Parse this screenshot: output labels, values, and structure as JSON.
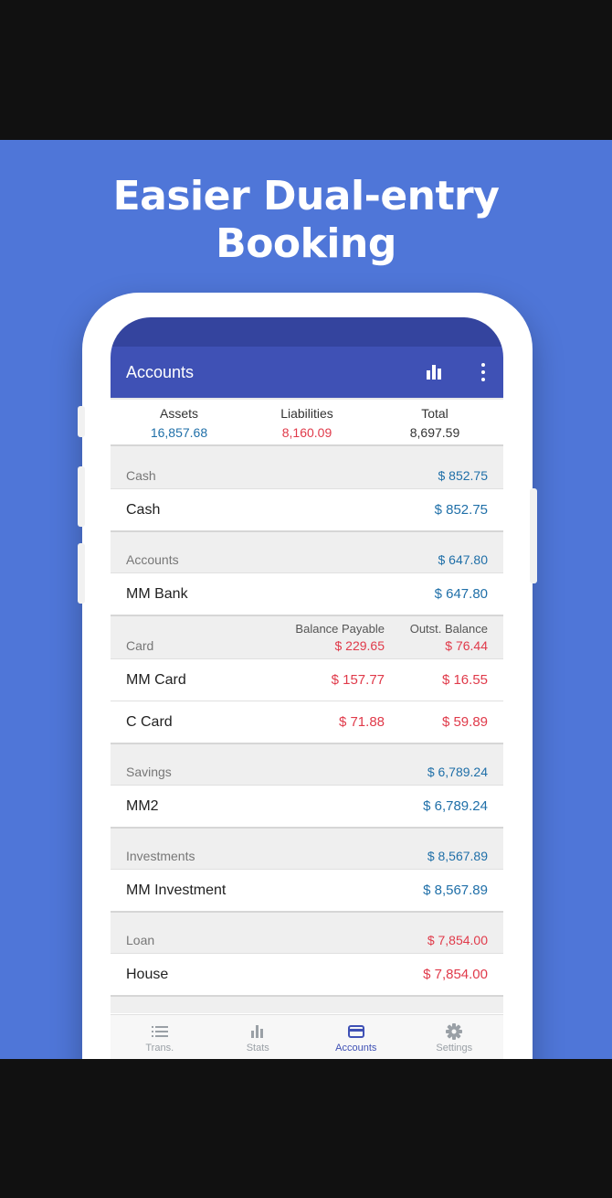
{
  "headline": {
    "line1": "Easier Dual-entry",
    "line2": "Booking"
  },
  "app": {
    "title": "Accounts",
    "icons": {
      "stats": "bar-chart-icon",
      "more": "more-vert-icon"
    }
  },
  "summary": {
    "assets_label": "Assets",
    "assets_value": "16,857.68",
    "liabilities_label": "Liabilities",
    "liabilities_value": "8,160.09",
    "total_label": "Total",
    "total_value": "8,697.59"
  },
  "groups": {
    "cash": {
      "name": "Cash",
      "amount": "$ 852.75",
      "rows": [
        {
          "name": "Cash",
          "amount": "$ 852.75"
        }
      ]
    },
    "accounts": {
      "name": "Accounts",
      "amount": "$ 647.80",
      "rows": [
        {
          "name": "MM Bank",
          "amount": "$ 647.80"
        }
      ]
    },
    "card": {
      "name": "Card",
      "balance_payable_label": "Balance Payable",
      "balance_payable": "$ 229.65",
      "outst_balance_label": "Outst. Balance",
      "outst_balance": "$ 76.44",
      "rows": [
        {
          "name": "MM Card",
          "payable": "$ 157.77",
          "outst": "$ 16.55"
        },
        {
          "name": "C Card",
          "payable": "$ 71.88",
          "outst": "$ 59.89"
        }
      ]
    },
    "savings": {
      "name": "Savings",
      "amount": "$ 6,789.24",
      "rows": [
        {
          "name": "MM2",
          "amount": "$ 6,789.24"
        }
      ]
    },
    "investments": {
      "name": "Investments",
      "amount": "$ 8,567.89",
      "rows": [
        {
          "name": "MM Investment",
          "amount": "$ 8,567.89"
        }
      ]
    },
    "loan": {
      "name": "Loan",
      "amount": "$ 7,854.00",
      "rows": [
        {
          "name": "House",
          "amount": "$ 7,854.00"
        }
      ]
    }
  },
  "nav": [
    {
      "label": "Trans.",
      "icon": "list-icon"
    },
    {
      "label": "Stats",
      "icon": "bar-chart-icon"
    },
    {
      "label": "Accounts",
      "icon": "card-icon",
      "active": true
    },
    {
      "label": "Settings",
      "icon": "gear-icon"
    }
  ],
  "colors": {
    "background": "#4f76d8",
    "appbar": "#3f51b5",
    "asset_blue": "#1f6fa8",
    "liability_red": "#e03a4a"
  }
}
